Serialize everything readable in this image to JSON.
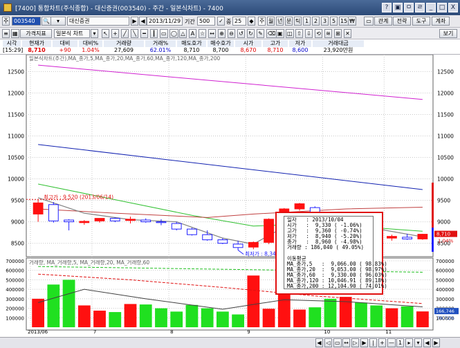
{
  "window": {
    "title": "[7400] 통합차트(주식종합) - 대신증권(003540) - 주간 - 일본식차트) - 7400",
    "buttons": [
      "?",
      "▣",
      "ㅁ",
      "ㄹ",
      "_",
      "□",
      "X"
    ]
  },
  "toolbar1": {
    "market_btn": "주",
    "code_value": "003540",
    "name_value": "대신증권",
    "date_value": "2013/11/29",
    "period_label": "기간",
    "period_value": "500",
    "interval_label": "중",
    "interval_value": "25",
    "unit_btns": [
      "년",
      "분",
      "틱",
      "1",
      "2",
      "3",
      "5",
      "15",
      "₩"
    ],
    "right_btns": [
      "관계",
      "전략",
      "도구",
      "계좌"
    ]
  },
  "toolbar2": {
    "price_index_btn": "가격지표",
    "chart_type_value": "일본식 차트",
    "view_btn": "보기"
  },
  "quote": {
    "headers": [
      "시각",
      "현재가",
      "대비",
      "대비%",
      "거래량",
      "거래%",
      "매도호가",
      "매수호가",
      "시가",
      "고가",
      "저가",
      "거래대금"
    ],
    "values": [
      "[15:29]",
      "8,710",
      "+90",
      "1.04%",
      "27,609",
      "62.01%",
      "8,710",
      "8,700",
      "8,670",
      "8,710",
      "8,600",
      "23,920만원"
    ],
    "colors": [
      "#000000",
      "#e00000",
      "#e00000",
      "#e00000",
      "#000000",
      "#0000cc",
      "#000000",
      "#000000",
      "#e00000",
      "#e00000",
      "#0000cc",
      "#000000"
    ]
  },
  "price_panel": {
    "legend": "일본식차트(주간),MA_종가,5,MA_종가,20,MA_종가,60,MA_종가,120,MA_종가,200",
    "y_ticks": [
      "12500",
      "12000",
      "11500",
      "11000",
      "10500",
      "10000",
      "9500",
      "9000",
      "8500"
    ],
    "high_label": "최고가 : 9,520 (2013/06/14)",
    "low_label": "최저가 : 8,340 (2013/08/30)",
    "current_price_badge": "8,710",
    "current_pct_badge": "1.04%"
  },
  "volume_panel": {
    "legend": "거래량, MA_거래량,5, MA_거래량,20, MA_거래량,60",
    "y_ticks": [
      "700000",
      "600000",
      "500000",
      "400000",
      "300000",
      "200000",
      "100000"
    ],
    "current_volume_badge": "166,746",
    "current_volume_pct_badge": "76.72%"
  },
  "x_axis": {
    "labels": [
      "2013/06",
      "7",
      "8",
      "9",
      "10",
      "11"
    ]
  },
  "tooltip": {
    "rows": [
      "일자   : 2013/10/04",
      "시가   :  9,330 ( -1.06%)",
      "고가   :  9,360 ( -0.74%)",
      "저가   :  8,940 ( -5.20%)",
      "종가   :  8,960 ( -4.98%)",
      "거래량 : 186,040 ( 49.05%)",
      "",
      "이동평균",
      "MA_종가,5   :  9,066.00 ( 98.83%)",
      "MA_종가,20  :  9,053.00 ( 98.97%)",
      "MA_종가,60  :  9,330.00 ( 96.03%)",
      "MA_종가,120 : 10,046.91 ( 89.18%)",
      "MA_종가,200 : 12,104.90 ( 74.01%)"
    ]
  },
  "colors": {
    "up": "#ff1010",
    "down": "#2020ff",
    "ma5": "#808080",
    "ma20": "#c04040",
    "ma60": "#30c030",
    "ma120": "#1020b0",
    "ma200": "#d020d0",
    "highlight": "#e01010"
  },
  "chart_data": {
    "type": "candlestick",
    "candles": [
      {
        "o": 9180,
        "h": 9520,
        "l": 9000,
        "c": 9440
      },
      {
        "o": 9400,
        "h": 9460,
        "l": 8980,
        "c": 9020
      },
      {
        "o": 9040,
        "h": 9060,
        "l": 8800,
        "c": 9000
      },
      {
        "o": 8980,
        "h": 9040,
        "l": 8930,
        "c": 9010
      },
      {
        "o": 9020,
        "h": 9080,
        "l": 8980,
        "c": 9080
      },
      {
        "o": 9080,
        "h": 9100,
        "l": 8990,
        "c": 9020
      },
      {
        "o": 9030,
        "h": 9120,
        "l": 8960,
        "c": 9060
      },
      {
        "o": 9040,
        "h": 9080,
        "l": 8980,
        "c": 9000
      },
      {
        "o": 9000,
        "h": 9060,
        "l": 8920,
        "c": 8980
      },
      {
        "o": 8960,
        "h": 9000,
        "l": 8800,
        "c": 8830
      },
      {
        "o": 8830,
        "h": 8860,
        "l": 8680,
        "c": 8700
      },
      {
        "o": 8700,
        "h": 8800,
        "l": 8560,
        "c": 8580
      },
      {
        "o": 8580,
        "h": 8620,
        "l": 8480,
        "c": 8500
      },
      {
        "o": 8480,
        "h": 8560,
        "l": 8340,
        "c": 8400
      },
      {
        "o": 8410,
        "h": 8540,
        "l": 8360,
        "c": 8520
      },
      {
        "o": 8520,
        "h": 9080,
        "l": 8480,
        "c": 9060
      },
      {
        "o": 9060,
        "h": 9320,
        "l": 9000,
        "c": 9300
      },
      {
        "o": 9300,
        "h": 9440,
        "l": 9260,
        "c": 9420
      },
      {
        "o": 9330,
        "h": 9360,
        "l": 8940,
        "c": 8960
      },
      {
        "o": 8960,
        "h": 9000,
        "l": 8780,
        "c": 8800
      },
      {
        "o": 8800,
        "h": 8960,
        "l": 8760,
        "c": 8920
      },
      {
        "o": 8920,
        "h": 9020,
        "l": 8760,
        "c": 8780
      },
      {
        "o": 8780,
        "h": 8820,
        "l": 8580,
        "c": 8620
      },
      {
        "o": 8620,
        "h": 8700,
        "l": 8560,
        "c": 8660
      },
      {
        "o": 8640,
        "h": 8720,
        "l": 8580,
        "c": 8600
      },
      {
        "o": 8600,
        "h": 8720,
        "l": 8580,
        "c": 8710
      }
    ],
    "volume": [
      300000,
      450000,
      500000,
      230000,
      175000,
      160000,
      245000,
      240000,
      200000,
      165000,
      235000,
      200000,
      165000,
      135000,
      545000,
      195000,
      380000,
      186040,
      210000,
      300000,
      320000,
      260000,
      230000,
      200000,
      220000,
      166746
    ],
    "volume_ylim": [
      0,
      700000
    ],
    "ylim": [
      8300,
      12700
    ],
    "ma200": [
      [
        0,
        12650
      ],
      [
        25,
        11850
      ]
    ],
    "ma120": [
      [
        0,
        10800
      ],
      [
        25,
        9750
      ]
    ],
    "ma60": [
      [
        0,
        9880
      ],
      [
        10,
        9150
      ],
      [
        14,
        8900
      ],
      [
        18,
        8960
      ],
      [
        25,
        8780
      ]
    ],
    "ma20": [
      [
        0,
        9300
      ],
      [
        5,
        9200
      ],
      [
        11,
        9100
      ],
      [
        14,
        9180
      ],
      [
        20,
        9300
      ],
      [
        25,
        9340
      ]
    ],
    "ma5": [
      [
        0,
        9560
      ],
      [
        3,
        9200
      ],
      [
        6,
        9050
      ],
      [
        9,
        9000
      ],
      [
        12,
        8620
      ],
      [
        14,
        8480
      ],
      [
        16,
        8880
      ],
      [
        18,
        9080
      ],
      [
        21,
        8900
      ],
      [
        25,
        8650
      ]
    ],
    "vol_ma5": [
      [
        0,
        260000
      ],
      [
        3,
        400000
      ],
      [
        7,
        300000
      ],
      [
        12,
        190000
      ],
      [
        16,
        290000
      ],
      [
        20,
        270000
      ],
      [
        25,
        215000
      ]
    ],
    "vol_ma20": [
      [
        0,
        560000
      ],
      [
        6,
        500000
      ],
      [
        12,
        420000
      ],
      [
        18,
        330000
      ],
      [
        25,
        250000
      ]
    ],
    "vol_ma60": [
      [
        0,
        640000
      ],
      [
        25,
        580000
      ]
    ]
  }
}
